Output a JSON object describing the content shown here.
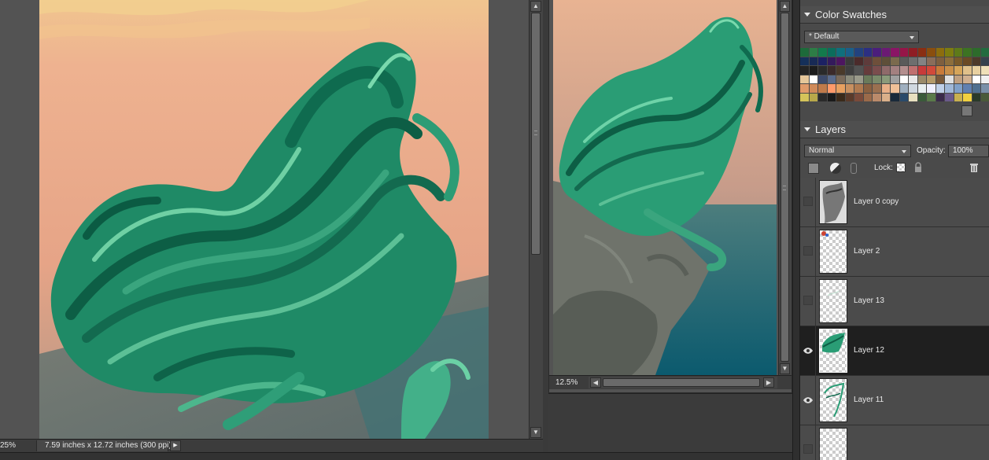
{
  "main_window": {
    "zoom": "25%",
    "doc_info": "7.59 inches x 12.72 inches (300 ppi)"
  },
  "navigator": {
    "zoom": "12.5%"
  },
  "color_swatches": {
    "title": "Color Swatches",
    "preset": "* Default",
    "colors": [
      "#1d6a3a",
      "#2d7d46",
      "#137a4c",
      "#0b6d5c",
      "#0f6f7d",
      "#1a5f8a",
      "#22427e",
      "#2c2f82",
      "#4b1e7c",
      "#6b1a74",
      "#8a1565",
      "#961548",
      "#8f1d24",
      "#8a2e12",
      "#8a4e0e",
      "#8d6d0e",
      "#7e7d10",
      "#5e7a19",
      "#3c7322",
      "#2d6b2b",
      "#226b3f",
      "#2d7d6a",
      "#3e6f8c",
      "#15305a",
      "#182a55",
      "#1c2163",
      "#341a5c",
      "#4d1660",
      "#3a3a3a",
      "#4b2b2b",
      "#5e3b3b",
      "#6e4f3a",
      "#5e4f39",
      "#7a6a4d",
      "#5a5a5a",
      "#6e6e6e",
      "#838383",
      "#8a6d5a",
      "#7e5f3f",
      "#8d6e3c",
      "#7a5a2a",
      "#6b4a24",
      "#4e3a2a",
      "#36424d",
      "#46586a",
      "#3a4a5e",
      "#242424",
      "#1c1c1c",
      "#2a2a2a",
      "#3b2a2a",
      "#4a3a2a",
      "#3e3e3e",
      "#525252",
      "#663c3c",
      "#7a4d4d",
      "#8f6a6a",
      "#a38080",
      "#b48f8f",
      "#c07070",
      "#c83a3a",
      "#d14a3a",
      "#c87a3a",
      "#c88f4a",
      "#d6a55a",
      "#e0c08a",
      "#e8d0a0",
      "#efe0b8",
      "#f2ead0",
      "#ffffff",
      "#e6c79a",
      "#ffffff",
      "#3d4a6b",
      "#5a6a8a",
      "#7a6a5a",
      "#8a8a7a",
      "#9a9a8a",
      "#6a7a5a",
      "#7a8a6a",
      "#8a9a7a",
      "#a0a0a0",
      "#ffffff",
      "#e8e8e8",
      "#9a8a6a",
      "#b49a6a",
      "#7a5a3a",
      "#e0e0e0",
      "#c0a080",
      "#d0b090",
      "#ffffff",
      "#f0f0f0",
      "#6a6a6a",
      "#8a8a8a",
      "#e09a6a",
      "#d08a5a",
      "#c07a4a",
      "#ff9a6a",
      "#e8a060",
      "#c89060",
      "#b07a50",
      "#8a6040",
      "#9a7050",
      "#e8b088",
      "#f0c098",
      "#a0b0c0",
      "#d0d8e0",
      "#e8eef0",
      "#f0f0ff",
      "#c0d0e8",
      "#a0b8d8",
      "#80a0c8",
      "#6080b0",
      "#507090",
      "#7a90a8",
      "#90a8c0",
      "#c0c0c0",
      "#d4c35a",
      "#b8a84a",
      "#2a2a2a",
      "#1a1a1a",
      "#3a2a1a",
      "#5a3a2a",
      "#7a4a3a",
      "#9a6a4a",
      "#ba8a6a",
      "#dab08a",
      "#1a2a3a",
      "#2a4a6a",
      "#e8e0c0",
      "#3a5a3a",
      "#5a7a4a",
      "#3a2a4a",
      "#6a5a8a",
      "#c8b050",
      "#f0d040",
      "#2a3a2a",
      "#4a5a3a",
      "#6a7a5a",
      "#8a9a7a"
    ]
  },
  "layers": {
    "title": "Layers",
    "blend_mode": "Normal",
    "opacity_label": "Opacity:",
    "opacity_value": "100%",
    "lock_label": "Lock:",
    "items": [
      {
        "name": "Layer 0 copy",
        "visible": false,
        "selected": false
      },
      {
        "name": "Layer 2",
        "visible": false,
        "selected": false
      },
      {
        "name": "Layer 13",
        "visible": false,
        "selected": false
      },
      {
        "name": "Layer 12",
        "visible": true,
        "selected": true
      },
      {
        "name": "Layer 11",
        "visible": true,
        "selected": false
      },
      {
        "name": "",
        "visible": false,
        "selected": false
      }
    ]
  },
  "colors": {
    "sky_top": "#f3c79b",
    "sky_bottom": "#d9a08a",
    "teal_dark": "#0c6b4e",
    "teal_mid": "#2a9a74",
    "teal_light": "#6ed3a8",
    "rock": "#6f756c",
    "sea": "#0f5e6a"
  }
}
